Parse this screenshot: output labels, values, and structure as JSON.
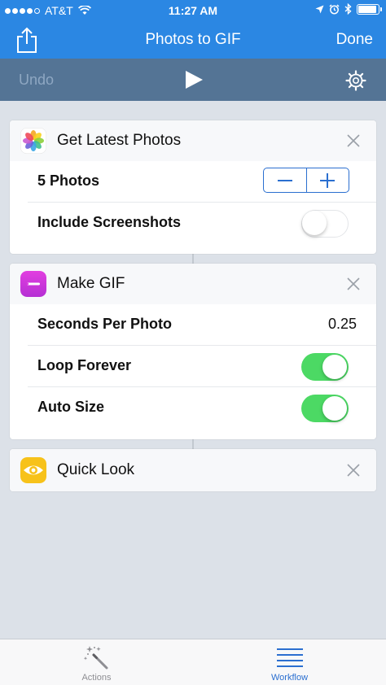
{
  "status_bar": {
    "carrier": "AT&T",
    "time": "11:27 AM",
    "battery_level": 0.85
  },
  "nav": {
    "title": "Photos to GIF",
    "done_label": "Done"
  },
  "toolbar": {
    "undo_label": "Undo"
  },
  "actions": [
    {
      "title": "Get Latest Photos",
      "icon": "photos-icon",
      "rows": [
        {
          "label": "5 Photos",
          "control": "stepper"
        },
        {
          "label": "Include Screenshots",
          "control": "toggle",
          "on": false
        }
      ]
    },
    {
      "title": "Make GIF",
      "icon": "make-gif-icon",
      "rows": [
        {
          "label": "Seconds Per Photo",
          "value": "0.25"
        },
        {
          "label": "Loop Forever",
          "control": "toggle",
          "on": true
        },
        {
          "label": "Auto Size",
          "control": "toggle",
          "on": true
        }
      ]
    },
    {
      "title": "Quick Look",
      "icon": "eye-icon",
      "rows": []
    }
  ],
  "tabs": [
    {
      "label": "Actions",
      "icon": "magic-wand-icon",
      "active": false
    },
    {
      "label": "Workflow",
      "icon": "list-icon",
      "active": true
    }
  ],
  "colors": {
    "primary_blue": "#2b87e3",
    "toolbar": "#547495",
    "toggle_on": "#4cd964",
    "tab_active": "#2b6fd0",
    "tab_inactive": "#8e8e93"
  }
}
